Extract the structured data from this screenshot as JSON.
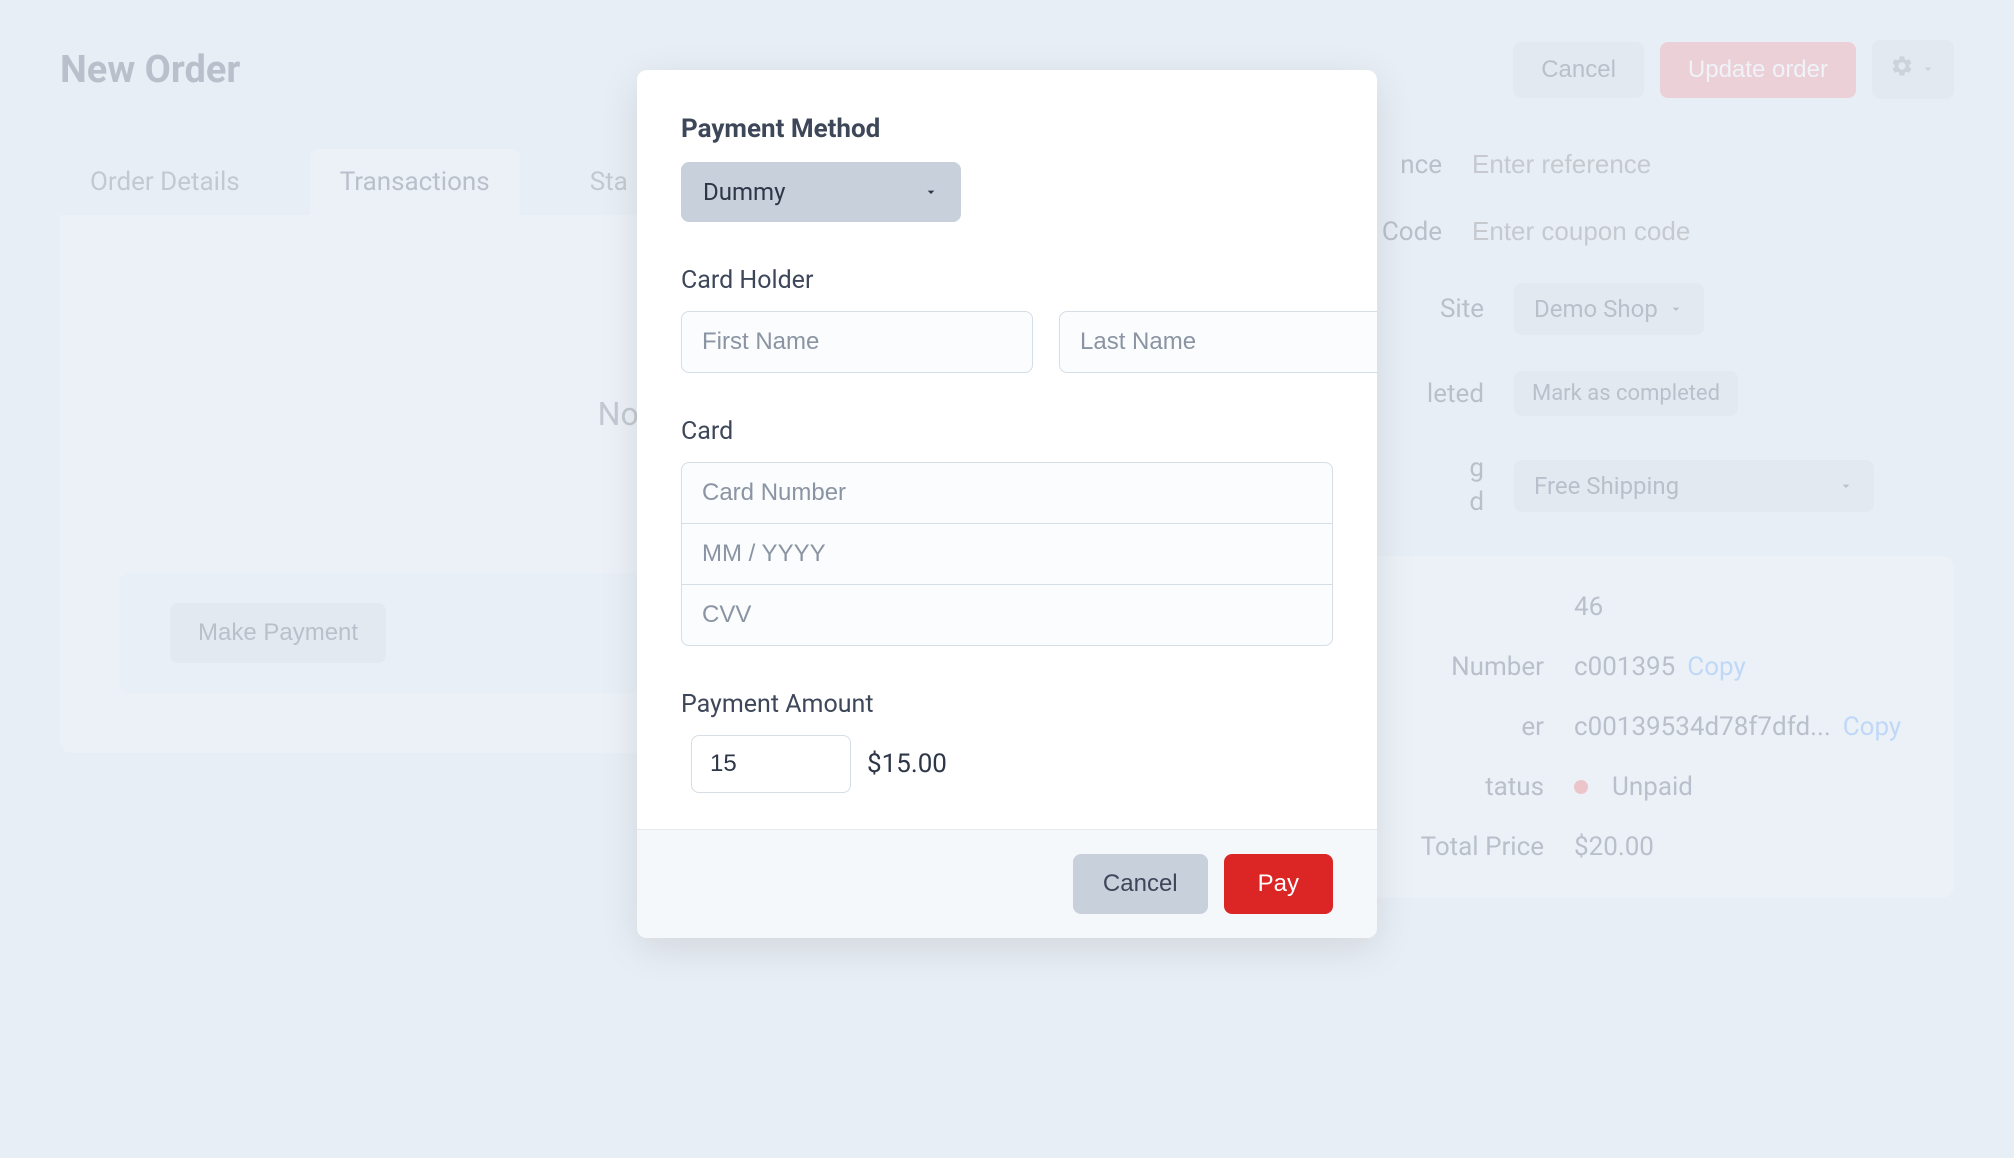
{
  "header": {
    "title": "New Order",
    "cancel": "Cancel",
    "update": "Update order"
  },
  "tabs": {
    "order_details": "Order Details",
    "transactions": "Transactions",
    "status_partial": "Sta"
  },
  "main": {
    "no_transactions": "No transa",
    "make_payment": "Make Payment"
  },
  "sidebar": {
    "reference_label_partial": "nce",
    "reference_placeholder": "Enter reference",
    "coupon_label_partial": "n Code",
    "coupon_placeholder": "Enter coupon code",
    "site_label_partial": "Site",
    "site_value": "Demo Shop",
    "completed_label_partial": "leted",
    "completed_badge": "Mark as completed",
    "shipping_label_partial_1": "g",
    "shipping_label_partial_2": "d",
    "shipping_value": "Free Shipping"
  },
  "summary": {
    "id_value": "46",
    "number_label": "Number",
    "number_value": "c001395",
    "ref_label_partial": "er",
    "ref_value": "c00139534d78f7dfd...",
    "copy": "Copy",
    "status_label_partial": "tatus",
    "status_value": "Unpaid",
    "total_label": "Total Price",
    "total_value": "$20.00"
  },
  "modal": {
    "title": "Payment Method",
    "method_value": "Dummy",
    "card_holder_label": "Card Holder",
    "first_name_placeholder": "First Name",
    "last_name_placeholder": "Last Name",
    "card_label": "Card",
    "card_number_placeholder": "Card Number",
    "expiry_placeholder": "MM / YYYY",
    "cvv_placeholder": "CVV",
    "amount_label": "Payment Amount",
    "amount_value": "15",
    "amount_display": "$15.00",
    "cancel": "Cancel",
    "pay": "Pay"
  }
}
